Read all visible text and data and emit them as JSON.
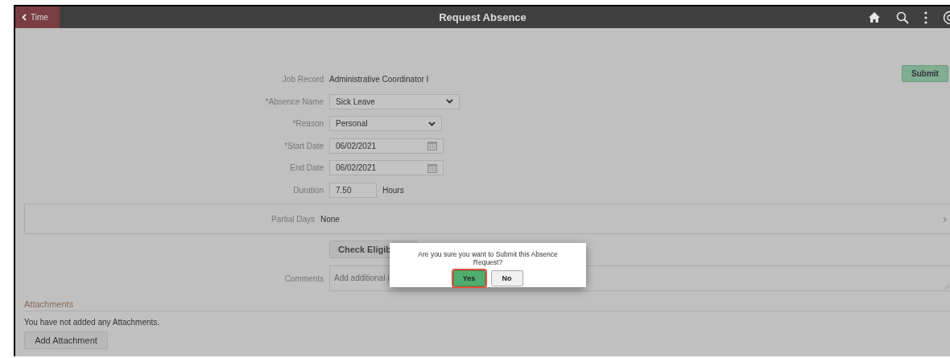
{
  "header": {
    "back_label": "Time",
    "title": "Request Absence"
  },
  "submit_label": "Submit",
  "fields": [
    {
      "kind": "text",
      "label": "Job Record",
      "value": "Administrative Coordinator I"
    },
    {
      "kind": "select",
      "label": "*Absence Name",
      "value": "Sick Leave"
    },
    {
      "kind": "select",
      "label": "*Reason",
      "value": "Personal"
    },
    {
      "kind": "date",
      "label": "*Start Date",
      "value": "06/02/2021"
    },
    {
      "kind": "date",
      "label": "End Date",
      "value": "06/02/2021"
    },
    {
      "kind": "number",
      "label": "Duration",
      "value": "7.50",
      "unit": "Hours"
    }
  ],
  "partial_days": {
    "label": "Partial Days",
    "value": "None"
  },
  "check_button": "Check Eligib",
  "comments": {
    "label": "Comments",
    "placeholder": "Add additional i"
  },
  "attachments": {
    "heading": "Attachments",
    "empty_text": "You have not added any Attachments.",
    "add_label": "Add Attachment"
  },
  "dialog": {
    "message": "Are you sure you want to Submit this Absence Request?",
    "buttons": [
      {
        "label": "Yes",
        "focused": true
      },
      {
        "label": "No",
        "focused": false
      }
    ]
  }
}
